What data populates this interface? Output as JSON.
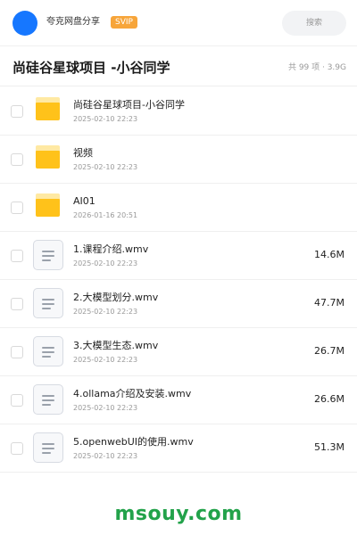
{
  "header": {
    "user_name": "夸克网盘分享",
    "vip_label": "SVIP",
    "search_placeholder": "搜索"
  },
  "folder": {
    "title": "尚硅谷星球项目 -小谷同学",
    "meta": "共 99 项 · 3.9G"
  },
  "items": [
    {
      "icon": "folder-icon",
      "name": "尚硅谷星球项目-小谷同学",
      "date": "2025-02-10 22:23",
      "size": ""
    },
    {
      "icon": "folder-icon",
      "name": "视频",
      "date": "2025-02-10 22:23",
      "size": ""
    },
    {
      "icon": "folder-icon",
      "name": "AI01",
      "date": "2026-01-16 20:51",
      "size": ""
    },
    {
      "icon": "video-file-icon",
      "name": "1.课程介绍.wmv",
      "date": "2025-02-10 22:23",
      "size": "14.6M"
    },
    {
      "icon": "video-file-icon",
      "name": "2.大模型划分.wmv",
      "date": "2025-02-10 22:23",
      "size": "47.7M"
    },
    {
      "icon": "video-file-icon",
      "name": "3.大模型生态.wmv",
      "date": "2025-02-10 22:23",
      "size": "26.7M"
    },
    {
      "icon": "video-file-icon",
      "name": "4.ollama介绍及安装.wmv",
      "date": "2025-02-10 22:23",
      "size": "26.6M"
    },
    {
      "icon": "video-file-icon",
      "name": "5.openwebUI的使用.wmv",
      "date": "2025-02-10 22:23",
      "size": "51.3M"
    }
  ],
  "watermark": "msouy.com",
  "colors": {
    "accent_blue": "#1677ff",
    "vip_orange": "#f7a53a",
    "folder_yellow": "#ffc21a",
    "watermark_green": "#22a24a"
  }
}
